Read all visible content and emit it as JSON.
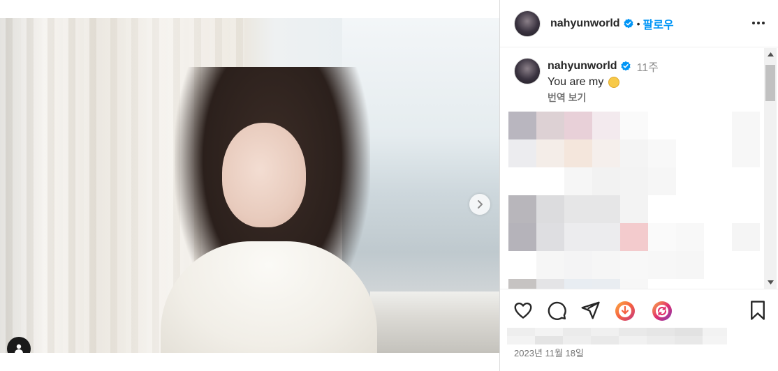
{
  "post": {
    "username": "nahyunworld",
    "follow_label": "팔로우",
    "separator": "•",
    "slides": 2,
    "active_slide": 1
  },
  "caption": {
    "username": "nahyunworld",
    "time_ago": "11주",
    "text": "You are my",
    "translate_label": "번역 보기"
  },
  "date": "2023년 11월 18일",
  "colors": {
    "accent": "#0095f6",
    "verified": "#0095f6",
    "text": "#262626",
    "muted": "#737373"
  },
  "icons": {
    "verified": "verified-badge-icon",
    "more": "more-options-icon",
    "next": "chevron-right-icon",
    "user_tag": "user-tag-icon",
    "like": "heart-icon",
    "comment": "comment-icon",
    "share": "share-icon",
    "ext1": "download-extension-icon",
    "ext2": "sync-extension-icon",
    "save": "bookmark-icon"
  }
}
